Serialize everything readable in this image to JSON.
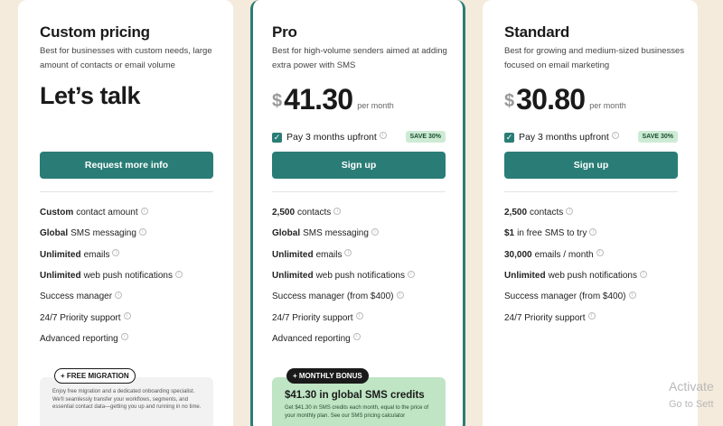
{
  "plans": [
    {
      "title": "Custom pricing",
      "description": "Best for businesses with custom needs, large amount of contacts or email volume",
      "headline": "Let’s talk",
      "button_label": "Request more info",
      "features": [
        {
          "bold": "Custom",
          "text": "contact amount"
        },
        {
          "bold": "Global",
          "text": "SMS messaging"
        },
        {
          "bold": "Unlimited",
          "text": "emails"
        },
        {
          "bold": "Unlimited",
          "text": "web push notifications"
        },
        {
          "bold": "",
          "text": "Success manager"
        },
        {
          "bold": "",
          "text": "24/7 Priority support"
        },
        {
          "bold": "",
          "text": "Advanced reporting"
        }
      ],
      "promo": {
        "badge": "+ FREE MIGRATION",
        "text": "Enjoy free migration and a dedicated onboarding specialist. We'll seamlessly transfer your workflows, segments, and essential contact data—getting you up and running in no time."
      }
    },
    {
      "title": "Pro",
      "description": "Best for high-volume senders aimed at adding extra power with SMS",
      "currency": "$",
      "price": "41.30",
      "period": "per month",
      "upfront_label": "Pay 3 months upfront",
      "save_badge": "SAVE 30%",
      "button_label": "Sign up",
      "features": [
        {
          "bold": "2,500",
          "text": "contacts"
        },
        {
          "bold": "Global",
          "text": "SMS messaging"
        },
        {
          "bold": "Unlimited",
          "text": "emails"
        },
        {
          "bold": "Unlimited",
          "text": "web push notifications"
        },
        {
          "bold": "",
          "text": "Success manager (from $400)"
        },
        {
          "bold": "",
          "text": "24/7 Priority support"
        },
        {
          "bold": "",
          "text": "Advanced reporting"
        }
      ],
      "promo": {
        "badge": "+ MONTHLY BONUS",
        "heading": "$41.30 in global SMS credits",
        "text": "Get $41.30 in SMS credits each month, equal to the price of your monthly plan. See our SMS pricing calculator"
      }
    },
    {
      "title": "Standard",
      "description": "Best for growing and medium-sized businesses focused on email marketing",
      "currency": "$",
      "price": "30.80",
      "period": "per month",
      "upfront_label": "Pay 3 months upfront",
      "save_badge": "SAVE 30%",
      "button_label": "Sign up",
      "features": [
        {
          "bold": "2,500",
          "text": "contacts"
        },
        {
          "bold": "$1",
          "text": "in free SMS to try"
        },
        {
          "bold": "30,000",
          "text": "emails / month"
        },
        {
          "bold": "Unlimited",
          "text": "web push notifications"
        },
        {
          "bold": "",
          "text": "Success manager (from $400)"
        },
        {
          "bold": "",
          "text": "24/7 Priority support"
        }
      ]
    }
  ],
  "watermark": {
    "line1": "Activate",
    "line2": "Go to Sett"
  },
  "colors": {
    "accent": "#2a7d76",
    "background": "#f5ebdc",
    "promo_green": "#bfe5c4"
  }
}
